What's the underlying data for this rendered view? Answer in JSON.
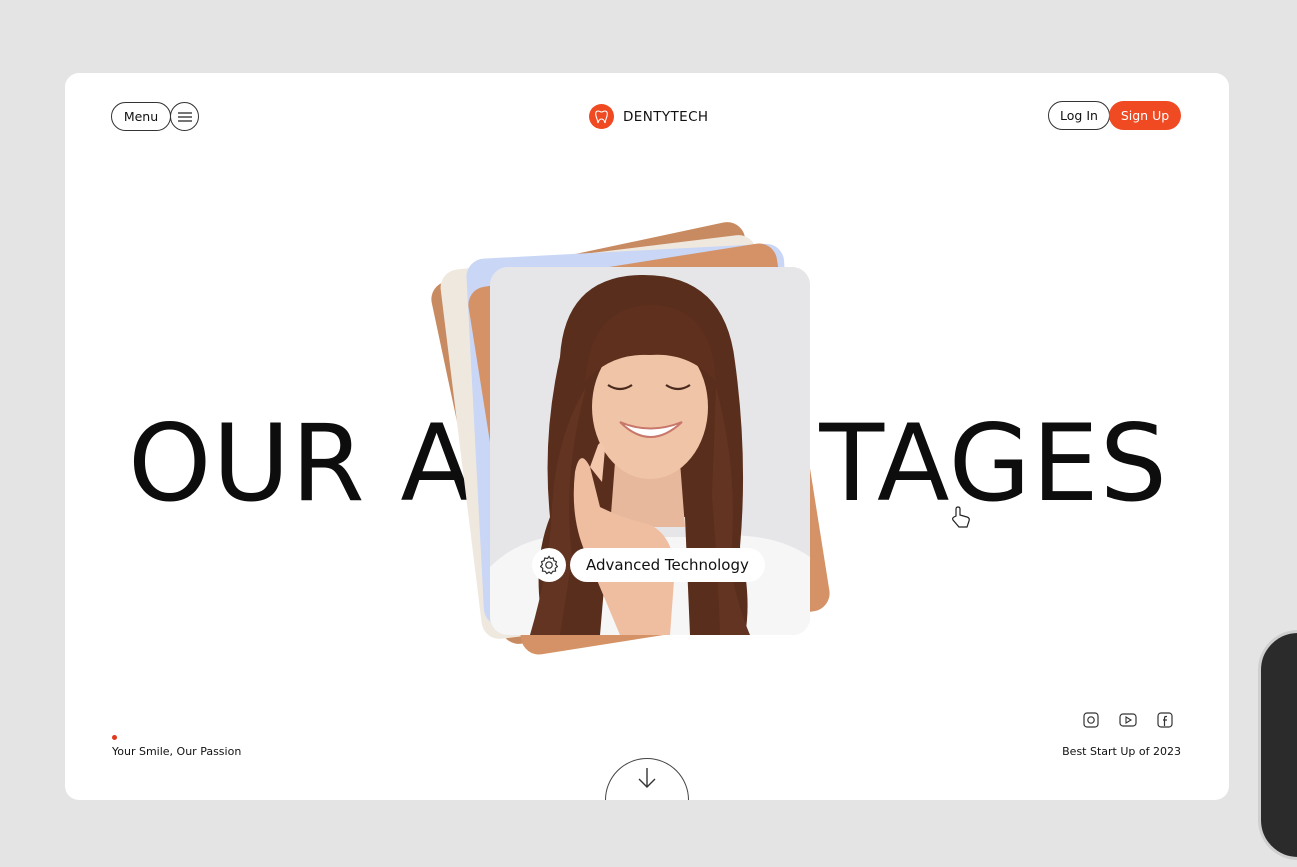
{
  "header": {
    "menu_label": "Menu",
    "menu_icon": "hamburger-icon",
    "brand_name": "DENTYTECH",
    "brand_icon": "tooth-icon",
    "login_label": "Log In",
    "signup_label": "Sign Up"
  },
  "hero": {
    "headline_left": "OUR A",
    "headline_right": "TAGES",
    "card_label": "Advanced Technology",
    "card_icon": "gear-icon"
  },
  "footer": {
    "tagline": "Your Smile, Our Passion",
    "award": "Best Start Up of 2023",
    "socials": [
      "instagram-icon",
      "youtube-icon",
      "facebook-icon"
    ],
    "scroll_icon": "arrow-down-icon"
  },
  "colors": {
    "accent": "#f04a23",
    "background": "#e4e4e4",
    "page": "#ffffff",
    "text": "#0d0d0d"
  }
}
